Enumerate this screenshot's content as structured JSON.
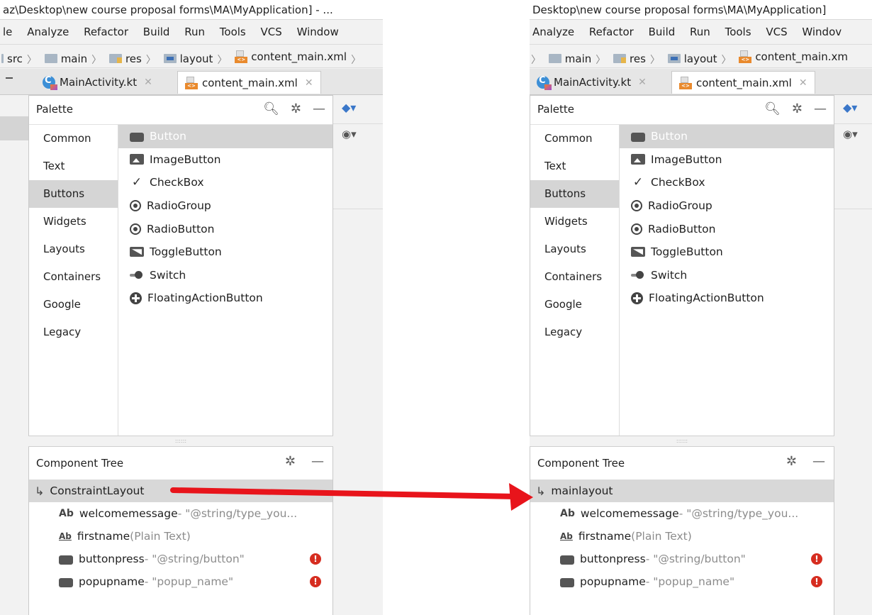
{
  "left": {
    "title": "az\\Desktop\\new course proposal forms\\MA\\MyApplication] - ...",
    "menu": [
      "le",
      "Analyze",
      "Refactor",
      "Build",
      "Run",
      "Tools",
      "VCS",
      "Window"
    ],
    "crumbs": [
      "src",
      "main",
      "res",
      "layout",
      "content_main.xml"
    ],
    "tabs": [
      "MainActivity.kt",
      "content_main.xml"
    ],
    "root_component": "ConstraintLayout"
  },
  "right": {
    "title": "Desktop\\new course proposal forms\\MA\\MyApplication]",
    "menu": [
      "Analyze",
      "Refactor",
      "Build",
      "Run",
      "Tools",
      "VCS",
      "Windov"
    ],
    "crumbs": [
      "main",
      "res",
      "layout",
      "content_main.xm"
    ],
    "tabs": [
      "MainActivity.kt",
      "content_main.xml"
    ],
    "root_component": "mainlayout"
  },
  "palette": {
    "title": "Palette",
    "categories": [
      "Common",
      "Text",
      "Buttons",
      "Widgets",
      "Layouts",
      "Containers",
      "Google",
      "Legacy"
    ],
    "selected_category": "Buttons",
    "items": [
      "Button",
      "ImageButton",
      "CheckBox",
      "RadioGroup",
      "RadioButton",
      "ToggleButton",
      "Switch",
      "FloatingActionButton"
    ]
  },
  "component_tree": {
    "title": "Component Tree",
    "children": [
      {
        "name": "welcomemessage",
        "value": "- \"@string/type_you...",
        "icon": "text-view-icon",
        "warning": false
      },
      {
        "name": "firstname",
        "value": "(Plain Text)",
        "icon": "edit-text-icon",
        "warning": false
      },
      {
        "name": "buttonpress",
        "value": "- \"@string/button\"",
        "icon": "button-icon",
        "warning": true
      },
      {
        "name": "popupname",
        "value": "- \"popup_name\"",
        "icon": "button-icon",
        "warning": true
      }
    ]
  },
  "colors": {
    "arrow": "#e8141b",
    "warning": "#d62d20",
    "selection": "#d4d4d4"
  }
}
